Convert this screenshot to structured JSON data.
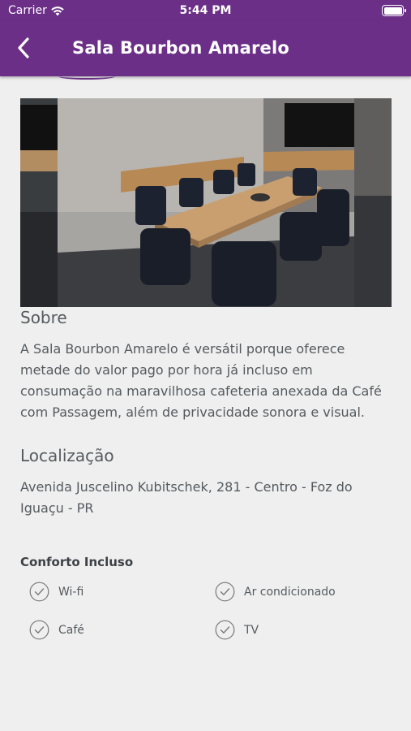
{
  "status_bar": {
    "carrier": "Carrier",
    "time": "5:44 PM"
  },
  "nav": {
    "title": "Sala Bourbon Amarelo"
  },
  "photo": {
    "alt": "Sala de reunião com mesa de madeira e cadeiras pretas"
  },
  "about": {
    "heading": "Sobre",
    "text": "A Sala Bourbon Amarelo é versátil porque oferece metade do valor pago por hora já incluso em consumação na maravilhosa cafeteria anexada da Café com Passagem, além de privacidade sonora e visual."
  },
  "location": {
    "heading": "Localização",
    "address": "Avenida Juscelino Kubitschek, 281 - Centro - Foz do Iguaçu - PR"
  },
  "comfort": {
    "heading": "Conforto Incluso",
    "items": [
      {
        "label": "Wi-fi"
      },
      {
        "label": "Ar condicionado"
      },
      {
        "label": "Café"
      },
      {
        "label": "TV"
      }
    ]
  },
  "colors": {
    "brand": "#6b2f87",
    "background": "#efefef",
    "text": "#555a5f"
  }
}
